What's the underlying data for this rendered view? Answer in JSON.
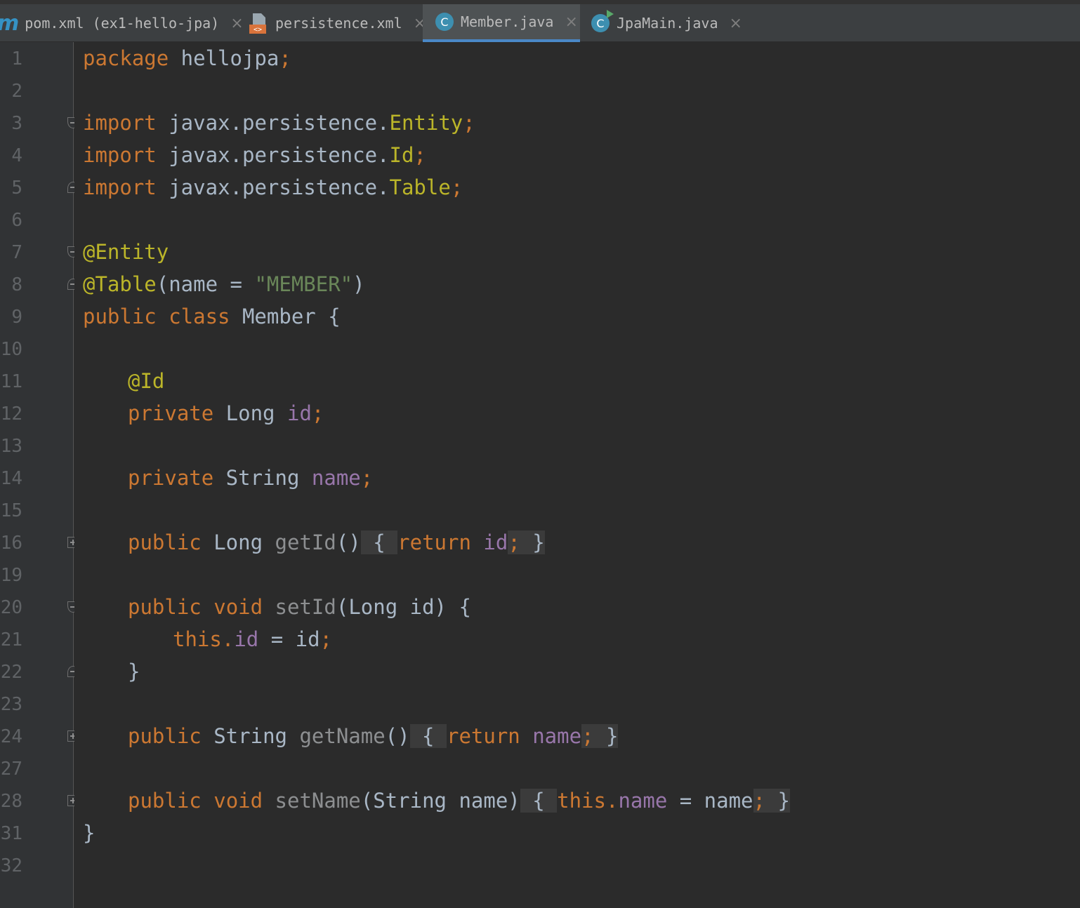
{
  "tabs": [
    {
      "label": "pom.xml (ex1-hello-jpa)",
      "icon": "maven-icon",
      "active": false
    },
    {
      "label": "persistence.xml",
      "icon": "xml-file-icon",
      "active": false
    },
    {
      "label": "Member.java",
      "icon": "java-class-icon",
      "active": true
    },
    {
      "label": "JpaMain.java",
      "icon": "java-runnable-class-icon",
      "active": false
    }
  ],
  "maven_glyph": "m",
  "class_glyph": "C",
  "close_glyph": "×",
  "line_numbers": [
    "1",
    "2",
    "3",
    "4",
    "5",
    "6",
    "7",
    "8",
    "9",
    "10",
    "11",
    "12",
    "13",
    "14",
    "15",
    "16",
    "19",
    "20",
    "21",
    "22",
    "23",
    "24",
    "27",
    "28",
    "31",
    "32"
  ],
  "code": {
    "package_kw": "package",
    "package_name": " hellojpa",
    "import_kw": "import",
    "import1_pkg": " javax.persistence.",
    "import1_cls": "Entity",
    "import2_pkg": " javax.persistence.",
    "import2_cls": "Id",
    "import3_pkg": " javax.persistence.",
    "import3_cls": "Table",
    "semicolon": ";",
    "ann_entity": "@Entity",
    "ann_table": "@Table",
    "table_open": "(name = ",
    "table_str": "\"MEMBER\"",
    "table_close": ")",
    "class_decl_kw": "public class",
    "class_decl_rest": " Member {",
    "ann_id": "@Id",
    "private_kw": "private",
    "field_id_type": " Long ",
    "field_id": "id",
    "field_name_type": " String ",
    "field_name": "name",
    "public_kw": "public",
    "getid_type": " Long ",
    "getid_name": "getId",
    "parens": "()",
    "brace_open": " { ",
    "return_kw": "return",
    "brace_close": " }",
    "void_kw": "void",
    "setid_name": "setId",
    "setid_params": "(Long id) {",
    "this_kw": "this",
    "dot": ".",
    "assign_id": " = id",
    "close_brace": "}",
    "getname_type": " String ",
    "getname_name": "getName",
    "setname_name": "setName",
    "setname_params": "(String name)",
    "assign_name": " = name",
    "class_close": "}"
  }
}
